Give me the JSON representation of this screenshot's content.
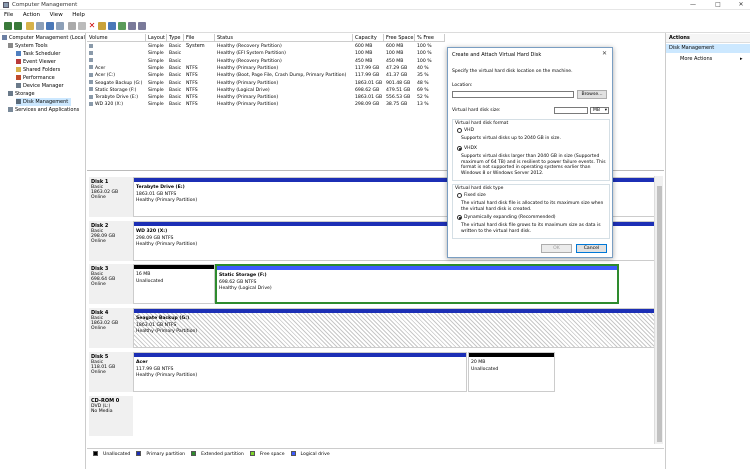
{
  "window": {
    "title": "Computer Management",
    "minimize": "—",
    "maximize": "□",
    "close": "✕"
  },
  "menu": [
    "File",
    "Action",
    "View",
    "Help"
  ],
  "tree": {
    "root": "Computer Management (Local",
    "items": [
      {
        "label": "System Tools",
        "indent": 1
      },
      {
        "label": "Task Scheduler",
        "indent": 2
      },
      {
        "label": "Event Viewer",
        "indent": 2
      },
      {
        "label": "Shared Folders",
        "indent": 2
      },
      {
        "label": "Performance",
        "indent": 2
      },
      {
        "label": "Device Manager",
        "indent": 2
      },
      {
        "label": "Storage",
        "indent": 1
      },
      {
        "label": "Disk Management",
        "indent": 2
      },
      {
        "label": "Services and Applications",
        "indent": 1
      }
    ]
  },
  "volumes": {
    "headers": [
      "Volume",
      "Layout",
      "Type",
      "File System",
      "Status",
      "Capacity",
      "Free Space",
      "% Free"
    ],
    "rows": [
      [
        "",
        "Simple",
        "Basic",
        "",
        "Healthy (Recovery Partition)",
        "600 MB",
        "600 MB",
        "100 %"
      ],
      [
        "",
        "Simple",
        "Basic",
        "",
        "Healthy (EFI System Partition)",
        "100 MB",
        "100 MB",
        "100 %"
      ],
      [
        "",
        "Simple",
        "Basic",
        "",
        "Healthy (Recovery Partition)",
        "450 MB",
        "450 MB",
        "100 %"
      ],
      [
        "Acer",
        "Simple",
        "Basic",
        "NTFS",
        "Healthy (Primary Partition)",
        "117.99 GB",
        "47.29 GB",
        "40 %"
      ],
      [
        "Acer (C:)",
        "Simple",
        "Basic",
        "NTFS",
        "Healthy (Boot, Page File, Crash Dump, Primary Partition)",
        "117.99 GB",
        "41.37 GB",
        "35 %"
      ],
      [
        "Seagate Backup (G:)",
        "Simple",
        "Basic",
        "NTFS",
        "Healthy (Primary Partition)",
        "1863.01 GB",
        "901.48 GB",
        "48 %"
      ],
      [
        "Static Storage (F:)",
        "Simple",
        "Basic",
        "NTFS",
        "Healthy (Logical Drive)",
        "698.62 GB",
        "479.51 GB",
        "69 %"
      ],
      [
        "Terabyte Drive (E:)",
        "Simple",
        "Basic",
        "NTFS",
        "Healthy (Primary Partition)",
        "1863.01 GB",
        "556.53 GB",
        "52 %"
      ],
      [
        "WD 320 (X:)",
        "Simple",
        "Basic",
        "NTFS",
        "Healthy (Primary Partition)",
        "298.09 GB",
        "38.75 GB",
        "13 %"
      ]
    ]
  },
  "disks": [
    {
      "name": "Disk 1",
      "type": "Basic",
      "size": "1863.02 GB",
      "status": "Online",
      "parts": [
        {
          "title": "Terabyte Drive (E:)",
          "size": "1863.01 GB NTFS",
          "status": "Healthy (Primary Partition)",
          "kind": "primary"
        }
      ]
    },
    {
      "name": "Disk 2",
      "type": "Basic",
      "size": "298.09 GB",
      "status": "Online",
      "parts": [
        {
          "title": "WD 320 (X:)",
          "size": "298.09 GB NTFS",
          "status": "Healthy (Primary Partition)",
          "kind": "primary"
        }
      ]
    },
    {
      "name": "Disk 3",
      "type": "Basic",
      "size": "698.64 GB",
      "status": "Online",
      "parts": [
        {
          "title": "",
          "size": "16 MB",
          "status": "Unallocated",
          "kind": "unallocated"
        },
        {
          "title": "Static Storage (F:)",
          "size": "698.62 GB NTFS",
          "status": "Healthy (Logical Drive)",
          "kind": "logical"
        }
      ]
    },
    {
      "name": "Disk 4",
      "type": "Basic",
      "size": "1863.02 GB",
      "status": "Online",
      "parts": [
        {
          "title": "Seagate Backup (G:)",
          "size": "1863.01 GB NTFS",
          "status": "Healthy (Primary Partition)",
          "kind": "primary"
        }
      ]
    },
    {
      "name": "Disk 5",
      "type": "Basic",
      "size": "118.01 GB",
      "status": "Online",
      "parts": [
        {
          "title": "Acer",
          "size": "117.99 GB NTFS",
          "status": "Healthy (Primary Partition)",
          "kind": "primary"
        },
        {
          "title": "",
          "size": "20 MB",
          "status": "Unallocated",
          "kind": "unallocated"
        }
      ]
    },
    {
      "name": "CD-ROM 0",
      "type": "DVD (L:)",
      "size": "",
      "status": "No Media",
      "parts": []
    }
  ],
  "legend": [
    {
      "label": "Unallocated",
      "color": "#000000"
    },
    {
      "label": "Primary partition",
      "color": "#1c2fb5"
    },
    {
      "label": "Extended partition",
      "color": "#2e8b2e"
    },
    {
      "label": "Free space",
      "color": "#7fd62a"
    },
    {
      "label": "Logical drive",
      "color": "#3d5bff"
    }
  ],
  "actions": {
    "header": "Actions",
    "section": "Disk Management",
    "more": "More Actions"
  },
  "dialog": {
    "title": "Create and Attach Virtual Hard Disk",
    "close": "✕",
    "intro": "Specify the virtual hard disk location on the machine.",
    "location_label": "Location:",
    "location_value": "",
    "browse": "Browse...",
    "size_label": "Virtual hard disk size:",
    "size_value": "",
    "size_unit": "MB",
    "format_label": "Virtual hard disk format",
    "vhd": "VHD",
    "vhd_desc": "Supports virtual disks up to 2040 GB in size.",
    "vhdx": "VHDX",
    "vhdx_desc": "Supports virtual disks larger than 2040 GB in size (Supported maximum of 64 TB) and is resilient to power failure events. This format is not supported in operating systems earlier than Windows 8 or Windows Server 2012.",
    "type_label": "Virtual hard disk type",
    "fixed": "Fixed size",
    "fixed_desc": "The virtual hard disk file is allocated to its maximum size when the virtual hard disk is created.",
    "dynamic": "Dynamically expanding (Recommended)",
    "dynamic_desc": "The virtual hard disk file grows to its maximum size as data is written to the virtual hard disk.",
    "ok": "OK",
    "cancel": "Cancel"
  },
  "colors": {
    "primary": "#1c2fb5",
    "logical": "#3d5bff",
    "extended": "#2e8b2e",
    "unallocated": "#000000",
    "selection": "#cce8ff"
  }
}
